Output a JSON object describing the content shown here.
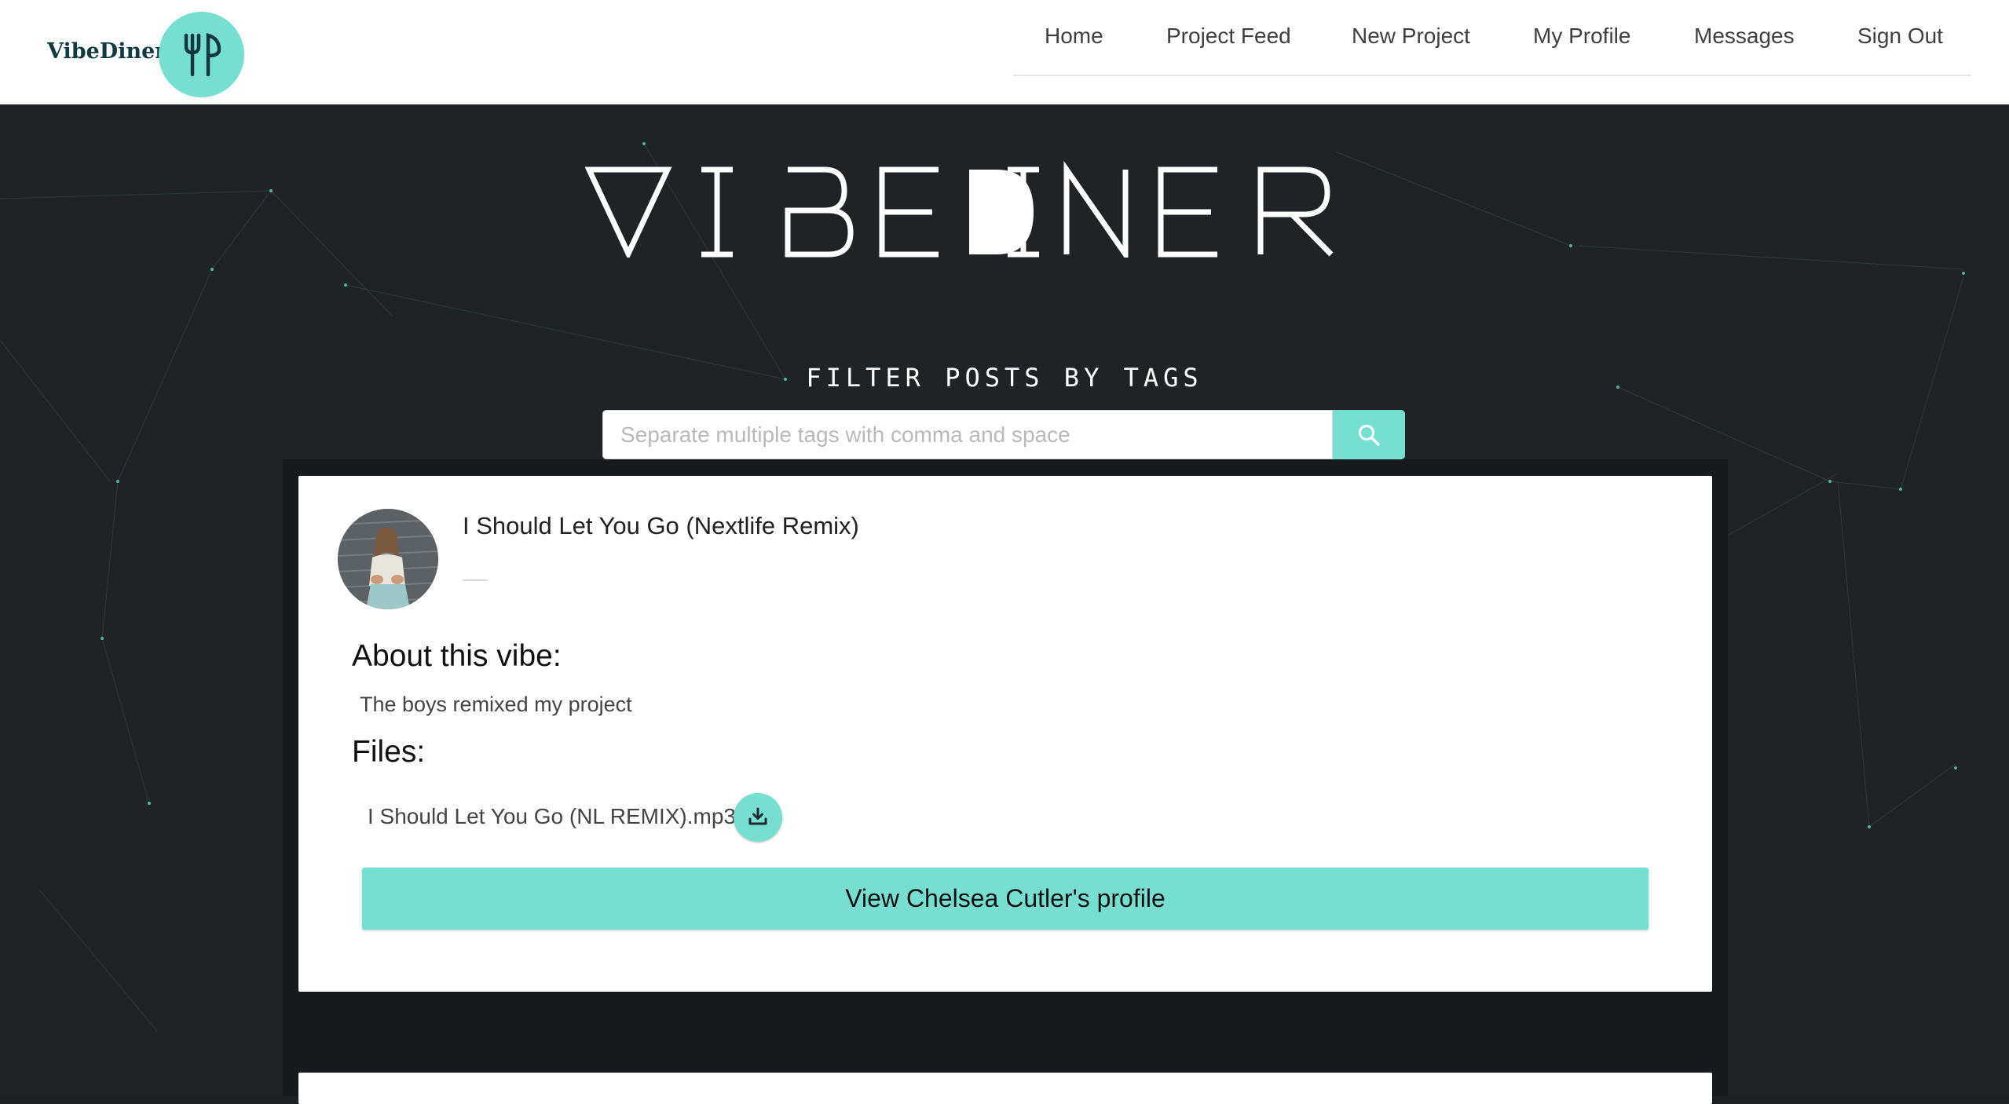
{
  "brand": {
    "name": "VibeDiner",
    "logo_icon": "fork-knife-icon",
    "accent_color": "#76dfd0"
  },
  "nav": {
    "items": [
      {
        "label": "Home"
      },
      {
        "label": "Project Feed"
      },
      {
        "label": "New Project"
      },
      {
        "label": "My Profile"
      },
      {
        "label": "Messages"
      },
      {
        "label": "Sign Out"
      }
    ]
  },
  "hero": {
    "title": "VIBEDINER",
    "filter_title": "FILTER POSTS BY TAGS",
    "search": {
      "placeholder": "Separate multiple tags with comma and space",
      "value": "",
      "icon": "search-icon"
    }
  },
  "posts": [
    {
      "title": "I Should Let You Go (Nextlife Remix)",
      "about_heading": "About this vibe:",
      "about_text": "The boys remixed my project",
      "files_heading": "Files:",
      "files": [
        {
          "name": "I Should Let You Go (NL REMIX).mp3",
          "icon": "download-icon"
        }
      ],
      "profile_button": "View Chelsea Cutler's profile"
    }
  ]
}
